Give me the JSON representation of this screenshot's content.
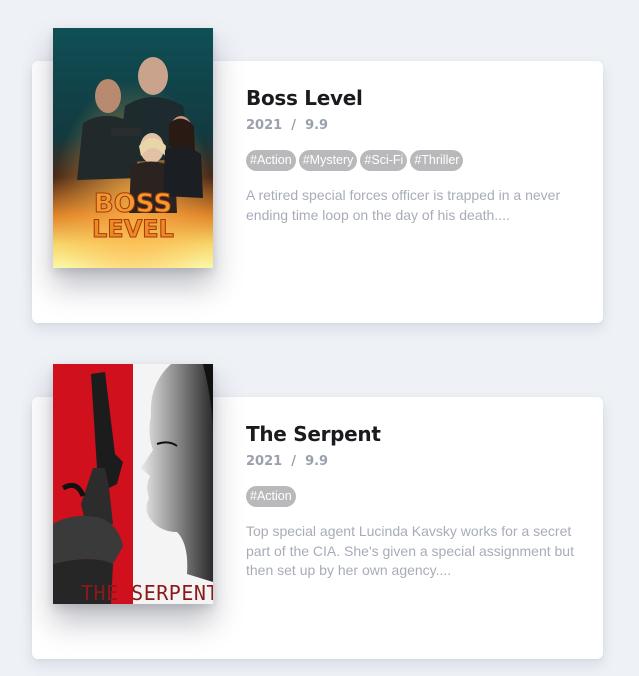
{
  "movies": [
    {
      "title": "Boss Level",
      "year": "2021",
      "separator": "/",
      "rating": "9.9",
      "genres": [
        "#Action",
        "#Mystery",
        "#Sci-Fi",
        "#Thriller"
      ],
      "summary": "A retired special forces officer is trapped in a never ending time loop on the day of his death....",
      "poster_text": [
        "BOSS",
        "LEVEL"
      ]
    },
    {
      "title": "The Serpent",
      "year": "2021",
      "separator": "/",
      "rating": "9.9",
      "genres": [
        "#Action"
      ],
      "summary": "Top special agent Lucinda Kavsky works for a secret part of the CIA. She's given a special assignment but then set up by her own agency....",
      "poster_text": [
        "THE SERPENT"
      ]
    }
  ],
  "colors": {
    "page_background": "#eef1f6",
    "card_background": "#ffffff",
    "title": "#1b1b1f",
    "meta": "#9aa0ac",
    "genre_chip": "#b9b9bc",
    "summary": "#a7acb8",
    "serpent_red": "#d0101c"
  }
}
